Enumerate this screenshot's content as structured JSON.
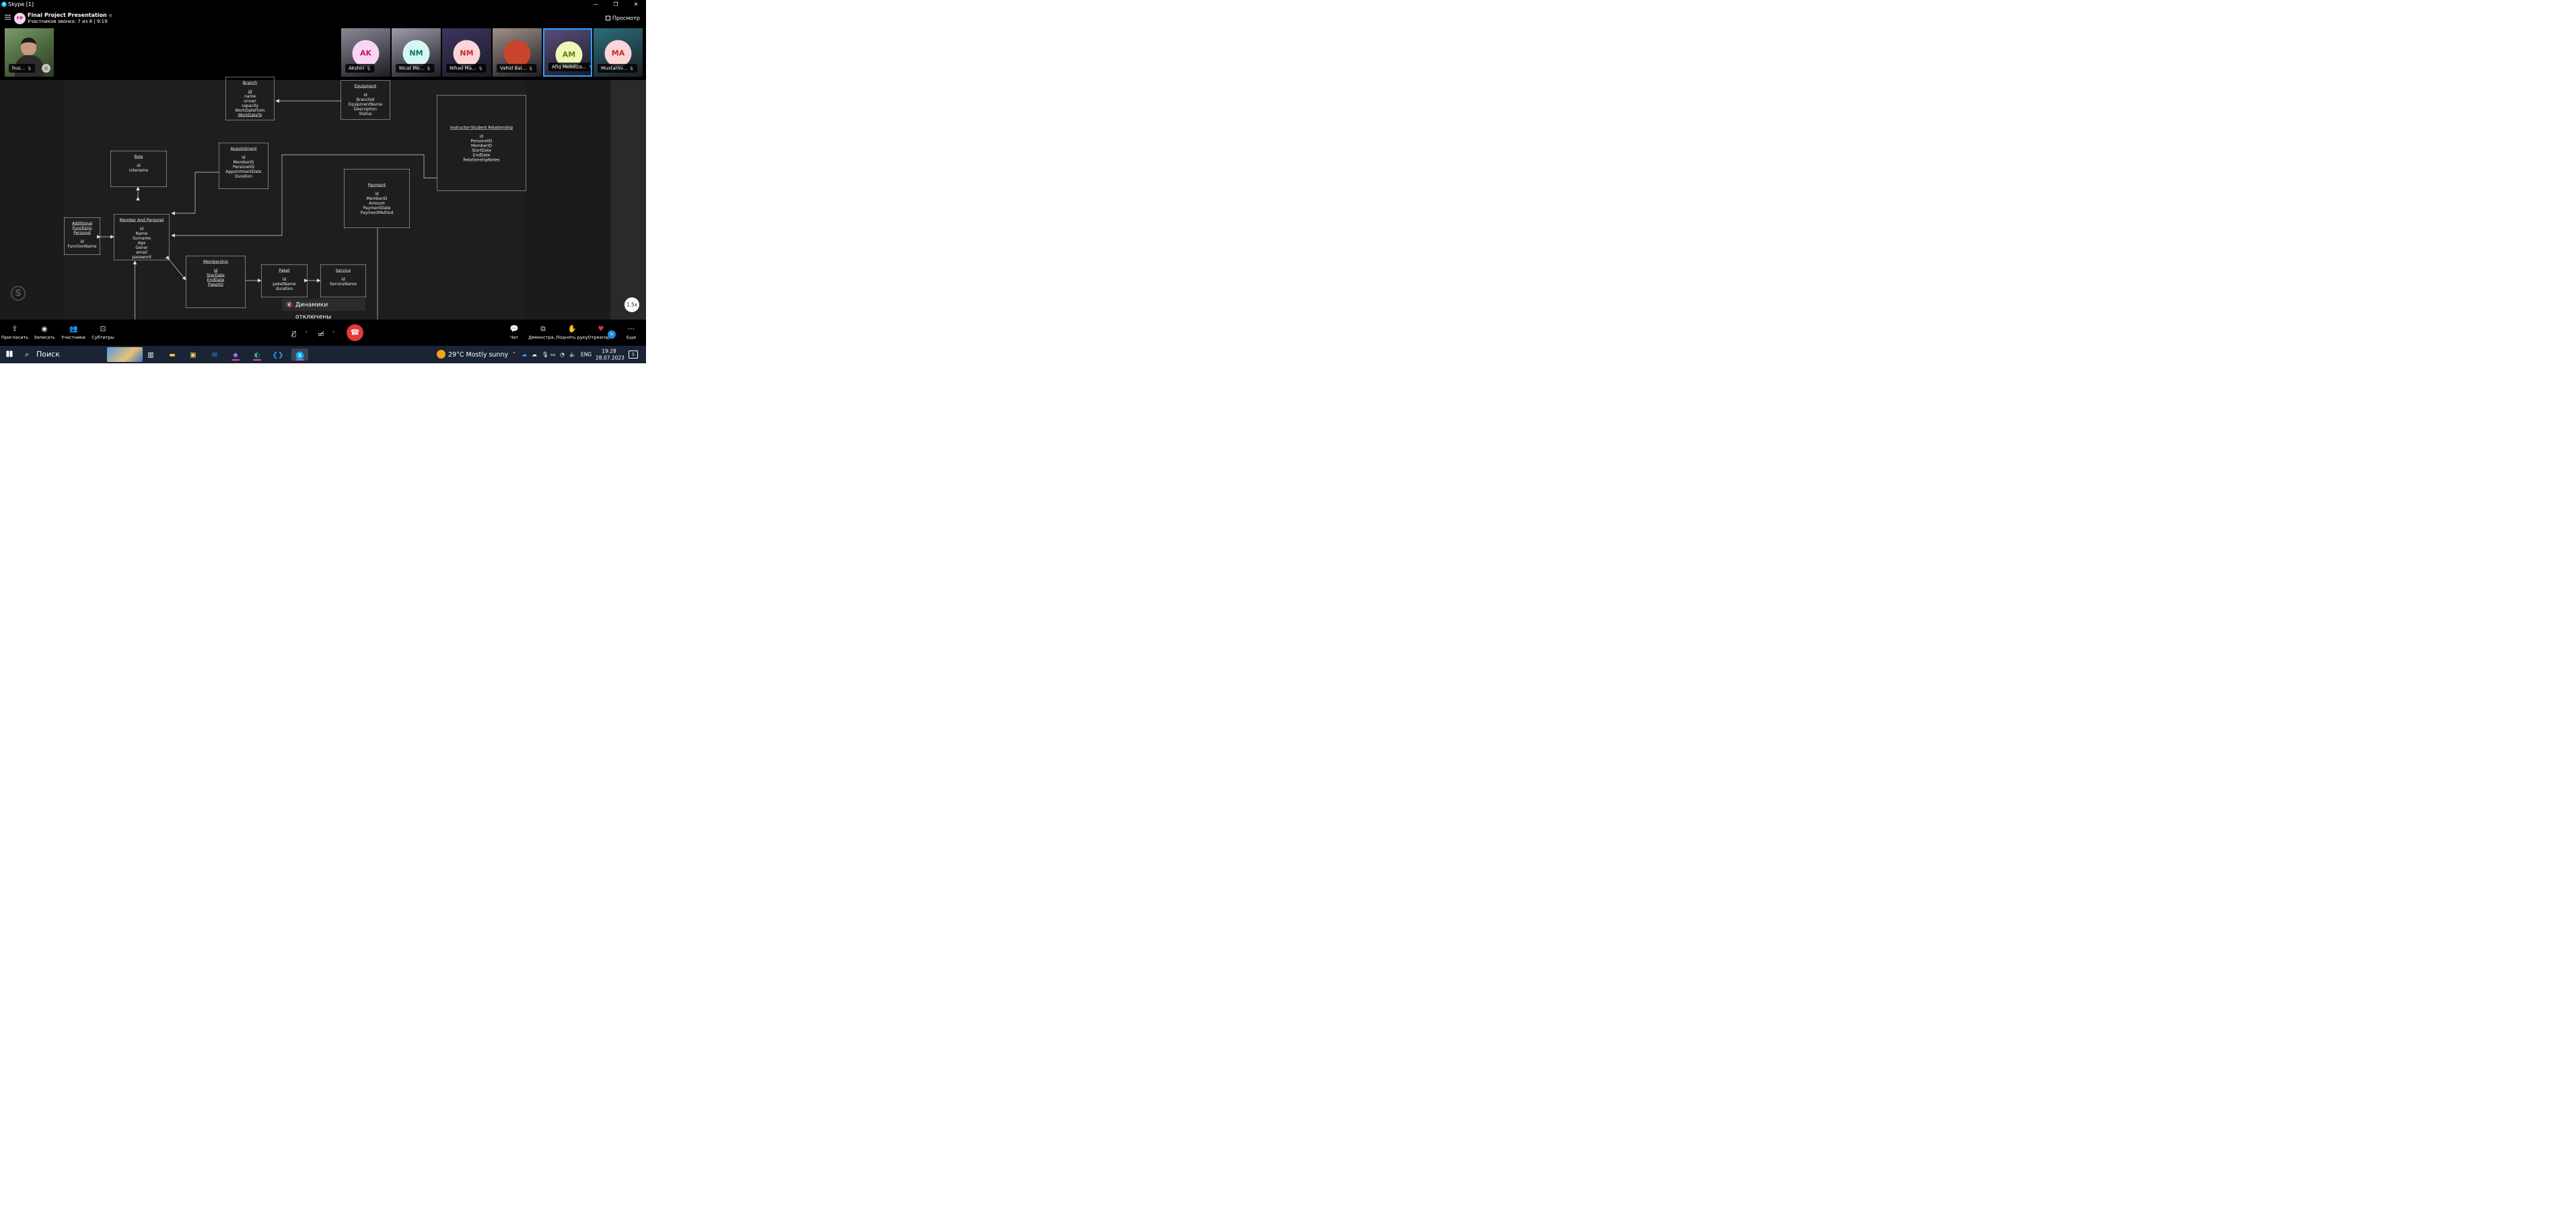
{
  "window": {
    "title": "Skype [1]",
    "app_icon": "S",
    "minimize_icon": "—",
    "restore_icon": "❐",
    "close_icon": "✕"
  },
  "call": {
    "avatar_initials": "FP",
    "title": "Final Project Presentation",
    "subtitle": "Участников звонка: 7 из 8 | 9:19",
    "view_label": "Просмотр"
  },
  "self_view": {
    "name": "hus..."
  },
  "participants": [
    {
      "initials": "AK",
      "name": "Akshin",
      "face_bg": "#f8d6f3",
      "initials_color": "#c2185b",
      "tile_bg": "#8a8a96"
    },
    {
      "initials": "NM",
      "name": "Nicat Me...",
      "face_bg": "#d7f5f1",
      "initials_color": "#00796b",
      "tile_bg": "#9b9bab"
    },
    {
      "initials": "NM",
      "name": "Nihad Ma...",
      "face_bg": "#fbd5d8",
      "initials_color": "#c62828",
      "tile_bg": "#3d3460"
    },
    {
      "initials": "",
      "name": "Vahid Bal...",
      "face_bg": "#c9442c",
      "initials_color": "#ffffff",
      "tile_bg": "#a08f86"
    },
    {
      "initials": "AM",
      "name": "Afiq Mehdiza...",
      "face_bg": "#eef7b6",
      "initials_color": "#6a7c12",
      "tile_bg": "#5a4d7c"
    },
    {
      "initials": "MA",
      "name": "Muxtarov...",
      "face_bg": "#fbd5d8",
      "initials_color": "#c62828",
      "tile_bg": "#2a6f7a"
    }
  ],
  "diagram": {
    "boxes": [
      {
        "id": "branch",
        "title": "Branch",
        "fields": [
          "id",
          "name",
          "unvan",
          "capacity",
          "WorkDateFrom",
          "WorkDateTo"
        ],
        "underlined": [
          "id",
          "WorkDateTo"
        ]
      },
      {
        "id": "equipment",
        "title": "Equipment",
        "fields": [
          "id",
          "BranchId",
          "EquipmentName",
          "Description",
          "Status"
        ],
        "underlined": []
      },
      {
        "id": "instructor",
        "title": "Instructor-Student Relationship",
        "fields": [
          "id",
          "PersonelID",
          "MemberID",
          "StartDate",
          "EndDate",
          "RelationshipNotes"
        ],
        "underlined": []
      },
      {
        "id": "role",
        "title": "Role",
        "fields": [
          "id",
          "rolename"
        ],
        "underlined": []
      },
      {
        "id": "appointment",
        "title": "Appointment",
        "fields": [
          "id",
          "MemberID",
          "PersonelID",
          "AppointmentDate",
          "Duration"
        ],
        "underlined": []
      },
      {
        "id": "payment",
        "title": "Payment",
        "fields": [
          "id",
          "MemberID",
          "Amount",
          "PaymentDate",
          "PaymentMethod"
        ],
        "underlined": []
      },
      {
        "id": "additional",
        "title": "Additional Functions Personel",
        "fields": [
          "id",
          "FunctionName"
        ],
        "underlined": []
      },
      {
        "id": "member",
        "title": "Member And Personel",
        "fields": [
          "id",
          "Name",
          "Surname",
          "Age",
          "Gener",
          "email",
          "password"
        ],
        "underlined": []
      },
      {
        "id": "membership",
        "title": "Membership",
        "fields": [
          "id",
          "StarDate",
          "EndDate",
          "PaketID"
        ],
        "underlined": [
          "id",
          "StarDate",
          "EndDate",
          "PaketID"
        ]
      },
      {
        "id": "paket",
        "title": "Paket",
        "fields": [
          "id",
          "paketName",
          "duration"
        ],
        "underlined": []
      },
      {
        "id": "service",
        "title": "Service",
        "fields": [
          "id",
          "ServiceName"
        ],
        "underlined": []
      }
    ]
  },
  "speaker_toast": "Динамики отключены",
  "speed_label": "1.5x",
  "toolbar": {
    "invite": "Пригласить",
    "record": "Записать",
    "participants": "Участники",
    "subtitles": "Субтитры",
    "chat": "Чат",
    "share": "Демонстра...",
    "raise_hand": "Поднять руку",
    "react": "Отреагир...",
    "more": "Еще"
  },
  "taskbar": {
    "search_placeholder": "Поиск",
    "weather": "29°C  Mostly sunny",
    "language": "ENG",
    "time": "19:28",
    "date": "28.07.2023",
    "notifications": "5"
  }
}
